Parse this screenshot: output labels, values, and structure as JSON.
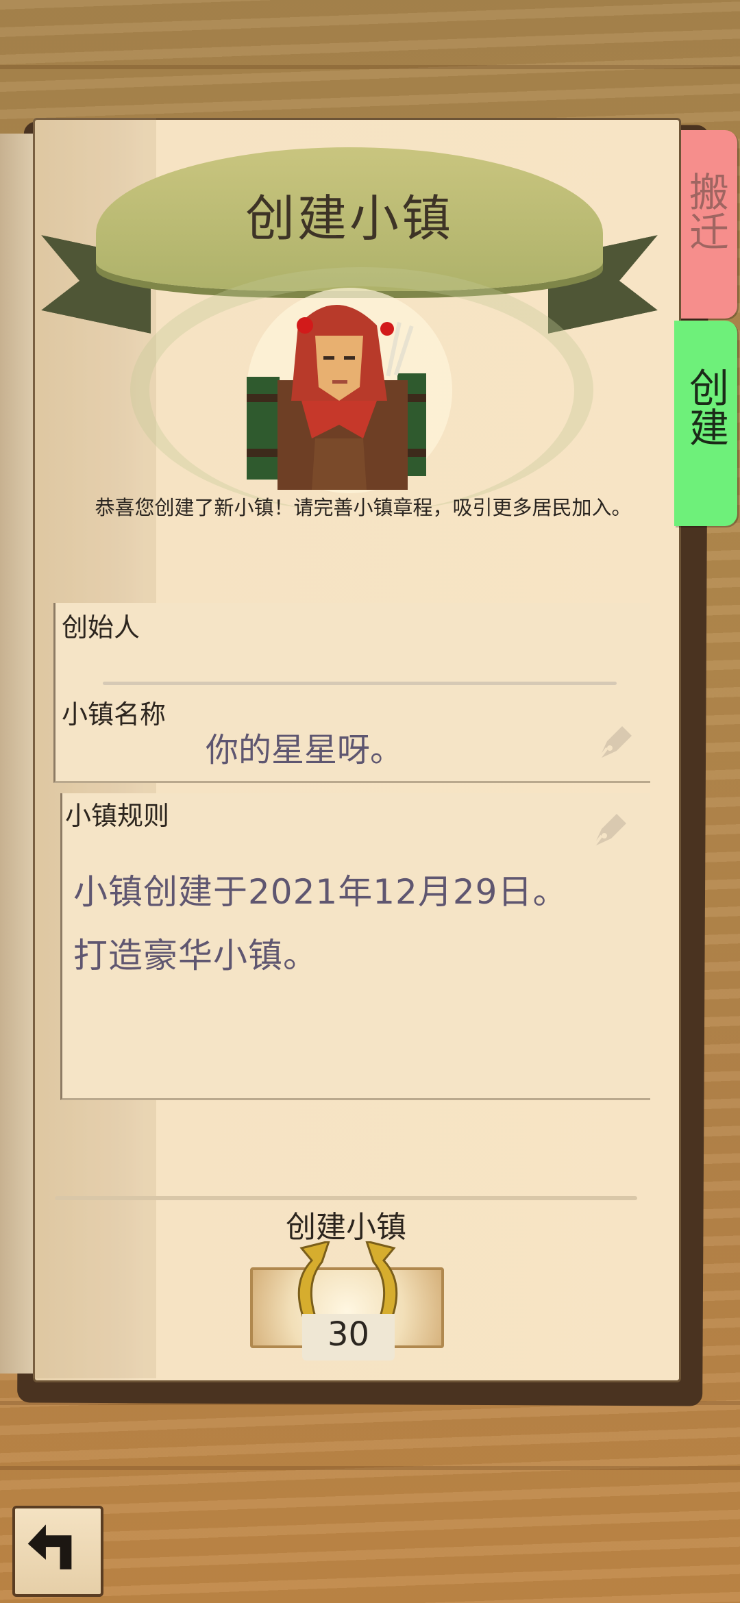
{
  "tabs": {
    "move": "搬迁",
    "create": "创建"
  },
  "banner": {
    "title": "创建小镇"
  },
  "subtitle": "恭喜您创建了新小镇！请完善小镇章程，吸引更多居民加入。",
  "form": {
    "founder_label": "创始人",
    "founder_value": "",
    "name_label": "小镇名称",
    "name_value": "你的星星呀。",
    "rules_label": "小镇规则",
    "rules_lines": [
      "小镇创建于2021年12月29日。",
      "打造豪华小镇。"
    ]
  },
  "create": {
    "label": "创建小镇",
    "cost": "30"
  },
  "icons": {
    "edit": "pen-nib-icon",
    "back": "back-arrow-icon",
    "currency": "horseshoe-icon"
  },
  "colors": {
    "tab_move": "#f68e8c",
    "tab_create": "#6ef07a",
    "banner": "#b7b974"
  }
}
